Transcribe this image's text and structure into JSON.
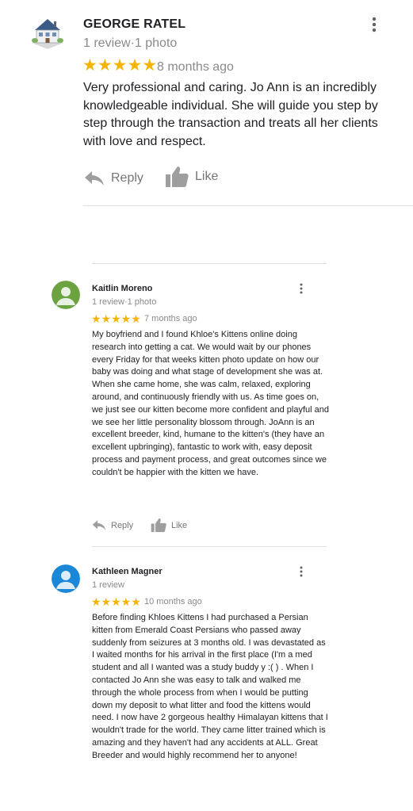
{
  "reviews": [
    {
      "name": "GEORGE RATEL",
      "meta": "1 review·1 photo",
      "stars": "★★★★★",
      "time": "8 months ago",
      "text": "Very professional and caring. Jo Ann is an incredibly knowledgeable individual. She will guide you step by step through the transaction and treats all her clients with love and respect.",
      "avatar_icon": "house-avatar-icon",
      "reply_label": "Reply",
      "like_label": "Like"
    },
    {
      "name": "Kaitlin Moreno",
      "meta": "1 review·1 photo",
      "stars": "★★★★★",
      "time": "7 months ago",
      "text": "My boyfriend and I found Khloe's Kittens online doing research into getting a cat. We would wait by our phones every Friday for that weeks kitten photo update on how our baby was doing and what stage of development she was at. When she came home, she was calm, relaxed, exploring around, and continuously friendly with us. As time goes on, we just see our kitten become more confident and playful and we see her little personality blossom through. JoAnn is an excellent breeder, kind, humane to the kitten's (they have an excellent upbringing), fantastic to work with, easy deposit process and payment process, and great outcomes since we couldn't be happier with the kitten we have.",
      "avatar_color": "#6aa33f",
      "avatar_icon": "person-avatar-icon",
      "reply_label": "Reply",
      "like_label": "Like"
    },
    {
      "name": "Kathleen Magner",
      "meta": "1 review",
      "stars": "★★★★★",
      "time": "10 months ago",
      "text": "Before finding Khloes Kittens I had purchased a Persian kitten from Emerald Coast Persians who passed away suddenly from seizures at 3 months old. I was devastated as I waited months for his arrival in the first place (I'm a med student and all I wanted was a study buddy y :( ) . When I contacted Jo Ann she was easy to talk and walked me through the whole process from when I would be putting down my deposit to what litter and food the kittens would need. I now have 2 gorgeous healthy Himalayan kittens that I wouldn't trade for the world. They came litter trained which is amazing and they haven't had any accidents at ALL. Great Breeder and would highly recommend her to anyone!",
      "avatar_color": "#1a88d6",
      "avatar_icon": "person-avatar-icon"
    }
  ],
  "colors": {
    "star": "#f4b400",
    "muted_text": "#8a8a8a",
    "action_gray": "#757575",
    "divider": "#e0e0e0"
  },
  "icons": {
    "more": "more-vert-icon",
    "reply": "reply-arrow-icon",
    "like": "thumbs-up-icon"
  }
}
